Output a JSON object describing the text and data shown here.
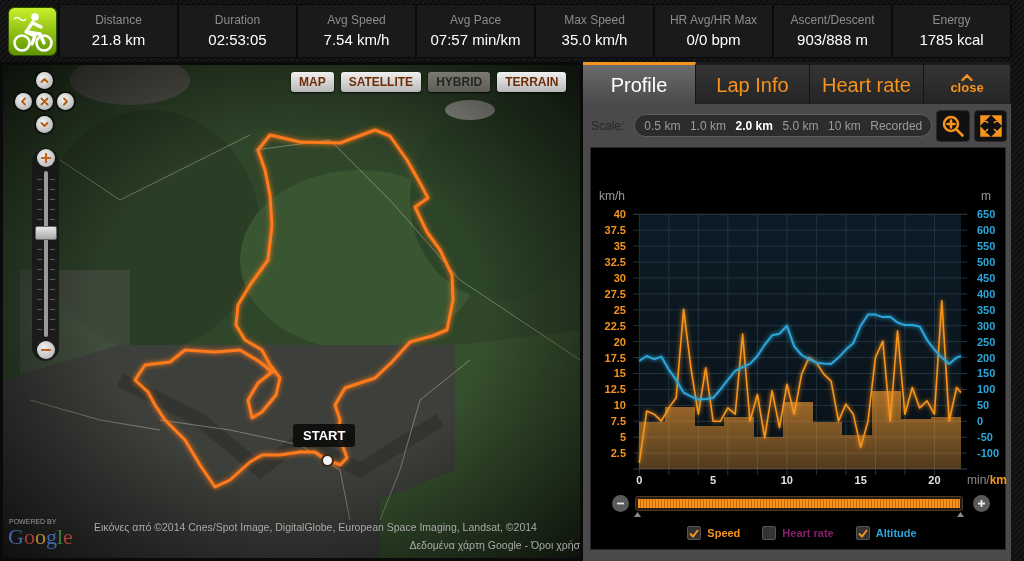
{
  "summary_bar": {
    "stats": [
      {
        "label": "Distance",
        "value": "21.8 km"
      },
      {
        "label": "Duration",
        "value": "02:53:05"
      },
      {
        "label": "Avg Speed",
        "value": "7.54 km/h"
      },
      {
        "label": "Avg Pace",
        "value": "07:57 min/km"
      },
      {
        "label": "Max Speed",
        "value": "35.0 km/h"
      },
      {
        "label": "HR Avg/HR Max",
        "value": "0/0 bpm"
      },
      {
        "label": "Ascent/Descent",
        "value": "903/888 m"
      },
      {
        "label": "Energy",
        "value": "1785 kcal"
      }
    ]
  },
  "map": {
    "map_types": [
      {
        "label": "MAP",
        "selected": false
      },
      {
        "label": "SATELLITE",
        "selected": false
      },
      {
        "label": "HYBRID",
        "selected": true
      },
      {
        "label": "TERRAIN",
        "selected": false
      }
    ],
    "zoom_slider": {
      "level": 0.635
    },
    "start_marker": {
      "label": "START"
    },
    "logo": {
      "caption": "POWERED BY",
      "wordmark": "Google"
    },
    "attribution": [
      "Εικόνες από ©2014 Cnes/Spot Image, DigitalGlobe, European Space Imaging, Landsat, ©2014",
      "Δεδομένα χάρτη Google - Όροι χρήσ"
    ]
  },
  "profile_panel": {
    "tabs": [
      {
        "label": "Profile",
        "kind": "text",
        "selected": true
      },
      {
        "label": "Lap Info",
        "kind": "text",
        "selected": false
      },
      {
        "label": "Heart rate",
        "kind": "text",
        "selected": false
      },
      {
        "label": "close",
        "kind": "collapse",
        "selected": false
      }
    ],
    "scale": {
      "label": "Scale:",
      "options": [
        {
          "label": "0.5 km",
          "selected": false
        },
        {
          "label": "1.0 km",
          "selected": false
        },
        {
          "label": "2.0 km",
          "selected": true
        },
        {
          "label": "5.0 km",
          "selected": false
        },
        {
          "label": "10 km",
          "selected": false
        },
        {
          "label": "Recorded",
          "selected": false
        }
      ]
    },
    "chart_data": {
      "type": "line",
      "grid": true,
      "ylabel": "km/h",
      "y2label": "m",
      "x": [
        0,
        0.5,
        1,
        1.5,
        2,
        2.5,
        3,
        3.5,
        4,
        4.5,
        5,
        5.5,
        6,
        6.5,
        7,
        7.5,
        8,
        8.5,
        9,
        9.5,
        10,
        10.5,
        11,
        11.5,
        12,
        12.5,
        13,
        13.5,
        14,
        14.5,
        15,
        15.5,
        16,
        16.5,
        17,
        17.5,
        18,
        18.5,
        19,
        19.5,
        20,
        20.5,
        21,
        21.5,
        21.8
      ],
      "xlim": [
        0,
        21.8
      ],
      "ylim": [
        0,
        40
      ],
      "y2lim": [
        -150,
        650
      ],
      "xticks": [
        0,
        5,
        10,
        15,
        20
      ],
      "yticks": [
        2.5,
        5,
        7.5,
        10,
        12.5,
        15,
        17.5,
        20,
        22.5,
        25,
        27.5,
        30,
        32.5,
        35,
        37.5,
        40
      ],
      "y2ticks": [
        -100,
        -50,
        0,
        50,
        100,
        150,
        200,
        250,
        300,
        350,
        400,
        450,
        500,
        550,
        600,
        650
      ],
      "series": [
        {
          "name": "Speed",
          "color": "#f7941d",
          "values": [
            1,
            9.1,
            8.6,
            7.5,
            9.6,
            11.2,
            25.1,
            15.9,
            8.6,
            15.9,
            7.5,
            7.5,
            9.6,
            8.6,
            21.2,
            7.5,
            11.7,
            4.9,
            12.3,
            6.5,
            13.3,
            8.6,
            14.9,
            17.5,
            16.7,
            14.9,
            13.8,
            7.5,
            10.2,
            8.6,
            3.4,
            7.5,
            17.5,
            20.1,
            7.5,
            21.7,
            8.6,
            12.8,
            9.6,
            10.7,
            8.6,
            26.4,
            7.5,
            12.8,
            12
          ]
        },
        {
          "name": "Heart rate",
          "color": "#8a1f6e",
          "values": [
            null,
            null,
            null,
            null,
            null,
            null,
            null,
            null,
            null,
            null,
            null,
            null,
            null,
            null,
            null,
            null,
            null,
            null,
            null,
            null,
            null,
            null,
            null,
            null,
            null,
            null,
            null,
            null,
            null,
            null,
            null,
            null,
            null,
            null,
            null,
            null,
            null,
            null,
            null,
            null,
            null,
            null,
            null,
            null,
            null
          ]
        },
        {
          "name": "Altitude",
          "color": "#2aa6da",
          "axis": "y2",
          "values": [
            190,
            205,
            195,
            203,
            162,
            130,
            90,
            78,
            68,
            70,
            73,
            100,
            130,
            158,
            170,
            180,
            205,
            240,
            270,
            275,
            300,
            235,
            208,
            195,
            184,
            181,
            180,
            200,
            225,
            245,
            300,
            335,
            335,
            327,
            328,
            310,
            302,
            302,
            298,
            255,
            225,
            200,
            180,
            200,
            205
          ]
        },
        {
          "type": "bar",
          "color": "#f59a30",
          "values": [
            7.4,
            7.4,
            7.4,
            7.4,
            9.8,
            9.8,
            9.8,
            9.8,
            6.7,
            6.7,
            6.7,
            6.7,
            8.2,
            8.2,
            8.2,
            8.2,
            5.1,
            5.1,
            5.1,
            5.1,
            10.5,
            10.5,
            10.5,
            10.5,
            7.4,
            7.4,
            7.4,
            7.4,
            5.3,
            5.3,
            5.3,
            5.3,
            12.3,
            12.3,
            12.3,
            12.3,
            7.8,
            7.8,
            7.8,
            7.8,
            8.2,
            8.2,
            8.2,
            8.2,
            8.2
          ]
        }
      ]
    },
    "legend": [
      {
        "checked": true
      },
      {
        "checked": false
      },
      {
        "checked": true
      }
    ],
    "x_units": [
      {
        "label": "min",
        "selected": false
      },
      {
        "label": "km",
        "selected": true
      }
    ],
    "x_unit_separator": "/",
    "range_slider": {
      "level": 1
    }
  }
}
